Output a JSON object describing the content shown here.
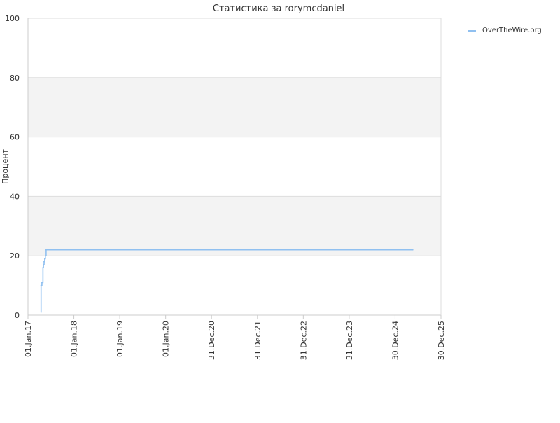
{
  "chart_data": {
    "type": "line",
    "title": "Статистика за rorymcdaniel",
    "xlabel": "",
    "ylabel": "Процент",
    "ylim": [
      0,
      100
    ],
    "yticks": [
      "0",
      "20",
      "40",
      "60",
      "80",
      "100"
    ],
    "xlim": [
      "2017-01-01",
      "2025-12-30"
    ],
    "xtick_labels": [
      "01.Jan.17",
      "01.Jan.18",
      "01.Jan.19",
      "01.Jan.20",
      "31.Dec.20",
      "31.Dec.21",
      "31.Dec.22",
      "31.Dec.23",
      "30.Dec.24",
      "30.Dec.25"
    ],
    "xtick_dates": [
      "2017-01-01",
      "2018-01-01",
      "2019-01-01",
      "2020-01-01",
      "2020-12-31",
      "2021-12-31",
      "2022-12-31",
      "2023-12-31",
      "2024-12-30",
      "2025-12-30"
    ],
    "grid": true,
    "alternating_bands": true,
    "legend_position": "top-right",
    "colors": {
      "series": "#90c0f0",
      "band": "#f3f3f3",
      "grid": "#dddddd",
      "axis": "#cccccc"
    },
    "series": [
      {
        "name": "OverTheWire.org",
        "x": [
          "2017-04-15",
          "2017-04-15",
          "2017-04-22",
          "2017-04-30",
          "2017-05-04",
          "2017-05-09",
          "2017-05-14",
          "2017-05-19",
          "2017-05-25",
          "2025-05-20"
        ],
        "y": [
          1,
          10,
          11,
          16,
          17,
          18,
          19,
          20,
          22,
          22
        ]
      }
    ]
  }
}
